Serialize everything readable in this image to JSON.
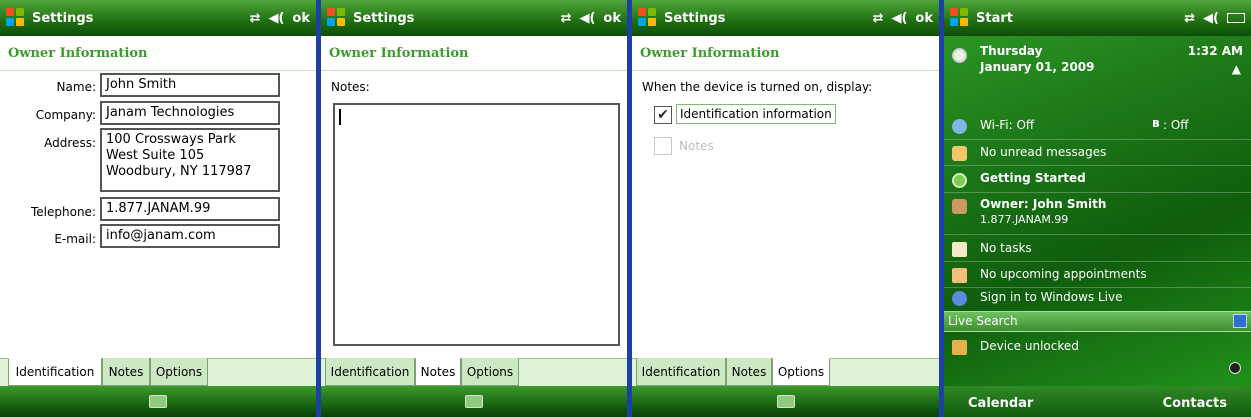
{
  "settings": {
    "title": "Settings",
    "ok": "ok",
    "header": "Owner Information"
  },
  "identification": {
    "name_label": "Name:",
    "name_value": "John Smith",
    "company_label": "Company:",
    "company_value": "Janam Technologies",
    "address_label": "Address:",
    "address_value": "100 Crossways Park\nWest Suite 105\nWoodbury, NY 117987",
    "telephone_label": "Telephone:",
    "telephone_value": "1.877.JANAM.99",
    "email_label": "E-mail:",
    "email_value": "info@janam.com"
  },
  "notes": {
    "label": "Notes:",
    "value": ""
  },
  "options": {
    "prompt": "When the device is turned on, display:",
    "identification_label": "Identification information",
    "identification_checked": true,
    "notes_label": "Notes",
    "notes_checked": false
  },
  "tabs": {
    "identification": "Identification",
    "notes": "Notes",
    "options": "Options"
  },
  "start": {
    "title": "Start",
    "time": "1:32 AM",
    "day": "Thursday",
    "date": "January 01, 2009",
    "wifi": "Wi-Fi: Off",
    "bluetooth": ": Off",
    "messages": "No unread messages",
    "getting_started": "Getting Started",
    "owner": "Owner: John Smith",
    "owner_phone": "1.877.JANAM.99",
    "tasks": "No tasks",
    "appointments": "No upcoming appointments",
    "live": "Sign in to Windows Live",
    "search": "Live Search",
    "lock": "Device unlocked",
    "left_softkey": "Calendar",
    "right_softkey": "Contacts"
  },
  "colors": {
    "accent_green": "#3e9a31",
    "divider_blue": "#1d3fa8"
  }
}
